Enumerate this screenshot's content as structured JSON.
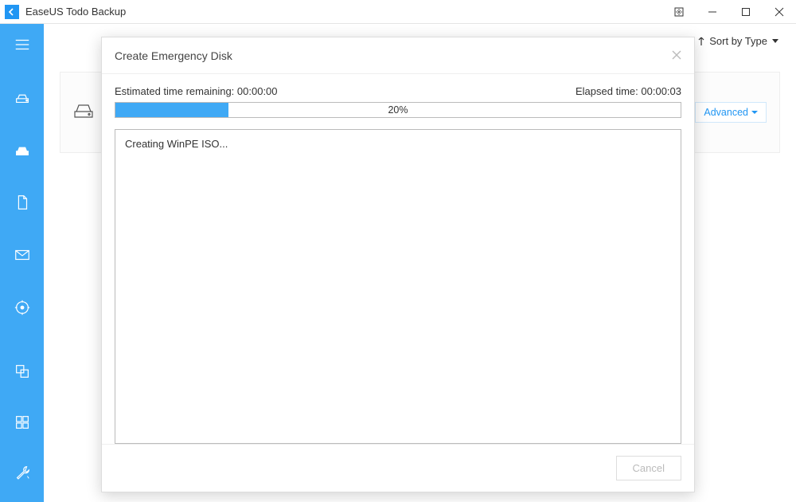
{
  "titlebar": {
    "app_name": "EaseUS Todo Backup"
  },
  "sidebar": {
    "top_icons": [
      "menu-icon",
      "disk-backup-icon",
      "system-backup-icon",
      "file-backup-icon",
      "mail-backup-icon",
      "smart-backup-icon"
    ],
    "bottom_icons": [
      "clone-icon",
      "tools-icon",
      "settings-icon"
    ]
  },
  "sortbar": {
    "label": "Sort by Type"
  },
  "card": {
    "advanced_label": "Advanced"
  },
  "modal": {
    "title": "Create Emergency Disk",
    "est_label": "Estimated time remaining:",
    "est_value": "00:00:00",
    "elapsed_label": "Elapsed time:",
    "elapsed_value": "00:00:03",
    "progress_percent": 20,
    "progress_text": "20%",
    "log_line": "Creating WinPE ISO...",
    "cancel_label": "Cancel"
  }
}
